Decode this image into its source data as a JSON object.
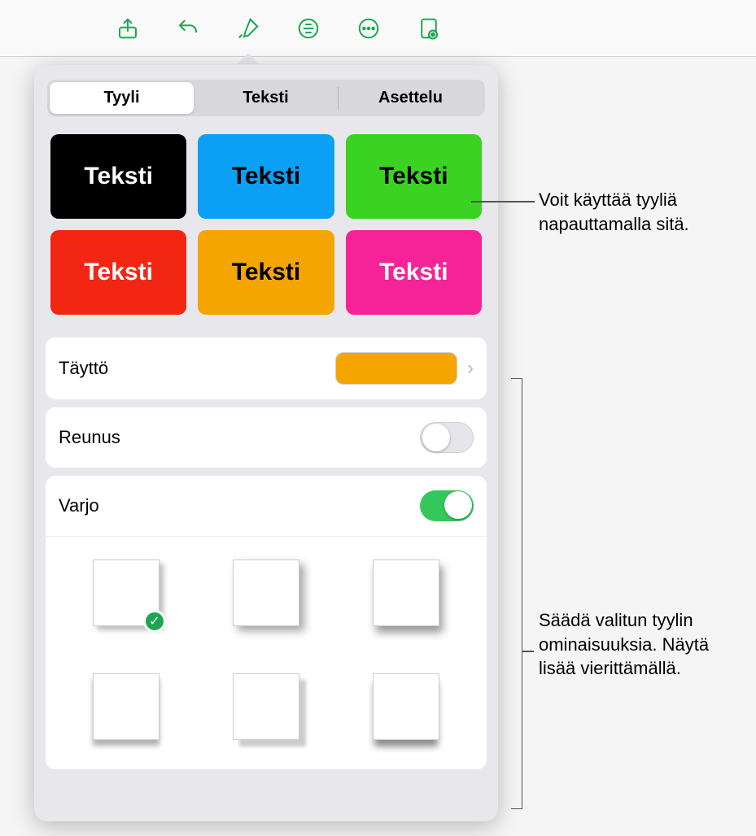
{
  "toolbar": {
    "share": "share-icon",
    "undo": "undo-icon",
    "format": "format-brush-icon",
    "insert": "insert-icon",
    "more": "more-icon",
    "document": "document-settings-icon"
  },
  "tabs": {
    "style": "Tyyli",
    "text": "Teksti",
    "layout": "Asettelu",
    "active": "style"
  },
  "styleSwatches": [
    {
      "label": "Teksti",
      "bg": "#000000",
      "fg": "#ffffff"
    },
    {
      "label": "Teksti",
      "bg": "#0aa0f5",
      "fg": "#000000"
    },
    {
      "label": "Teksti",
      "bg": "#3ad321",
      "fg": "#000000"
    },
    {
      "label": "Teksti",
      "bg": "#f22613",
      "fg": "#ffffff"
    },
    {
      "label": "Teksti",
      "bg": "#f5a500",
      "fg": "#000000"
    },
    {
      "label": "Teksti",
      "bg": "#f52397",
      "fg": "#ffffff"
    }
  ],
  "fill": {
    "label": "Täyttö",
    "color": "#f5a500"
  },
  "border": {
    "label": "Reunus",
    "enabled": false
  },
  "shadow": {
    "label": "Varjo",
    "enabled": true,
    "selected": 0
  },
  "callouts": {
    "applyStyle": "Voit käyttää tyyliä napauttamalla sitä.",
    "adjustProps": "Säädä valitun tyylin ominaisuuksia. Näytä lisää vierittämällä."
  }
}
